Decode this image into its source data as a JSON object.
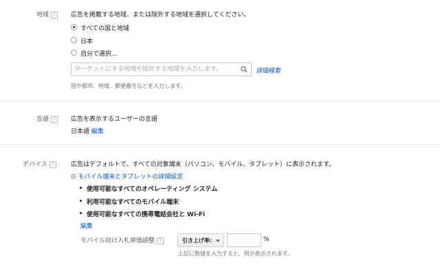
{
  "region": {
    "label": "地域",
    "help_glyph": "?",
    "description": "広告を掲載する地域、または除外する地域を選択してください。",
    "options": [
      {
        "label": "すべての国と地域",
        "selected": true
      },
      {
        "label": "日本",
        "selected": false
      },
      {
        "label": "自分で選択...",
        "selected": false
      }
    ],
    "search_placeholder": "ターゲットにする地域や除外する地域を入力します。",
    "advanced_search_link": "詳細検索",
    "hint": "国や都市、地域、郵便番号などを入力します。"
  },
  "language": {
    "label": "言語",
    "help_glyph": "?",
    "description": "広告を表示するユーザーの言語",
    "current_value": "日本語",
    "edit_link": "編集"
  },
  "devices": {
    "label": "デバイス",
    "help_glyph": "?",
    "description": "広告はデフォルトで、すべての対象端末（パソコン、モバイル、タブレット）に表示されます。",
    "toggle_glyph": "⊟",
    "mobile_settings_link": "モバイル端末とタブレットの詳細設定",
    "bullets": [
      "使用可能なすべてのオペレーティング システム",
      "利用可能なすべてのモバイル端末",
      "使用可能なすべての携帯電話会社と Wi-Fi"
    ],
    "edit_link": "編集",
    "bid_adjustment_label": "モバイル向け入札単価調整",
    "bid_select_value": "引き上げ率:",
    "bid_input_value": "",
    "percent_sign": "%",
    "bid_hint": "上記に数値を入力すると、例が表示されます。"
  },
  "colors": {
    "link": "#1155cc",
    "divider": "#e4e4e4"
  },
  "icons": {
    "search": "search-icon",
    "help": "help-icon",
    "collapse": "collapse-icon",
    "dropdown": "chevron-down-icon"
  }
}
